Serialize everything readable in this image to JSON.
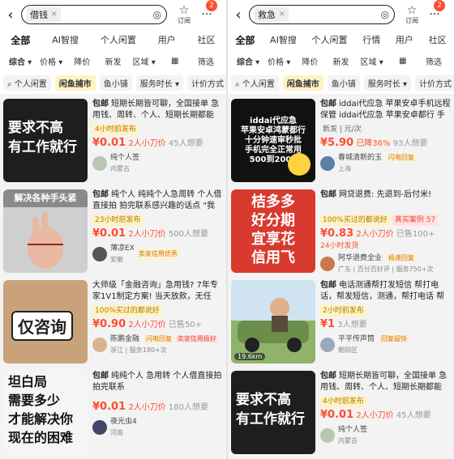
{
  "left": {
    "search_chip": "借钱",
    "fav_label": "订阅",
    "badge": "2",
    "tabs": [
      "全部",
      "AI智搜",
      "个人闲置",
      "用户",
      "社区"
    ],
    "filters": [
      "综合",
      "价格",
      "降价",
      "新发",
      "区域",
      "筛选"
    ],
    "pills": [
      "个人闲置",
      "闲鱼捕市",
      "鱼小铺",
      "服务时长",
      "计价方式"
    ],
    "items": [
      {
        "thumb_text": "要求不高\n有工作就行",
        "title": "短期长期皆可聊，全国接单 急用钱、周转、个人、短期长期都能",
        "tag": "4小时前发布",
        "price": "¥0.01",
        "sub": "2人小刀价",
        "want": "45人想要",
        "seller": "纯个人签",
        "loc": "内蒙古",
        "badges": []
      },
      {
        "thumb_text": "解决各种手头紧",
        "title": "纯个人 纯纯个人急周转 个人借直接拍 拍完联系感兴趣的话点 \"我",
        "tag": "23小时前发布",
        "price": "¥0.01",
        "sub": "2人小刀价",
        "want": "500人想要",
        "seller": "薄凉EX",
        "loc": "安徽",
        "badges": [
          "卖家信用优秀"
        ]
      },
      {
        "thumb_text": "仅咨询",
        "title": "大师级「金融咨询」急用钱? 7年专家1V1制定方案! 当天放款，无任",
        "tag": "100%买过的都说好",
        "price": "¥0.90",
        "sub": "2人小刀价",
        "want": "已售50+",
        "seller": "陈鹏金融",
        "loc": "浙江",
        "loc2": "服务180+次",
        "badges": [
          "闪电回复",
          "卖家信用极好"
        ]
      },
      {
        "thumb_text": "坦白局\n需要多少\n才能解决你\n现在的困难",
        "title": "纯纯个人 急用转 个人借直接拍 拍完联系",
        "tag": "",
        "price": "¥0.01",
        "sub": "2人小刀价",
        "want": "180人想要",
        "seller": "夜光虫4",
        "loc": "河南",
        "badges": []
      }
    ]
  },
  "right": {
    "search_chip": "救急",
    "fav_label": "订阅",
    "badge": "2",
    "tabs": [
      "全部",
      "AI智搜",
      "个人闲置",
      "行情",
      "用户",
      "社区"
    ],
    "filters": [
      "综合",
      "价格",
      "降价",
      "新发",
      "区域",
      "筛选"
    ],
    "pills": [
      "个人闲置",
      "闲鱼捕市",
      "鱼小铺",
      "服务时长",
      "计价方式"
    ],
    "items": [
      {
        "thumb_text": "iddai代应急\n苹果安卓鸿蒙都行\n十分钟速审秒批\n手机完全正常用\n500到2000",
        "title": "iddai代应急 苹果安卓手机远程保管 iddai代应急 苹果安卓都行 手机远",
        "tag": "新发 | 元/次",
        "price": "¥5.90",
        "sub": "已降36%",
        "want": "93人想要",
        "seller": "春城清新的玉",
        "loc": "上海",
        "badges": [
          "闪电回复"
        ]
      },
      {
        "thumb_text": "桔多多\n好分期\n宜享花\n信用飞",
        "title": "网贷退费: 先退到-后付米!",
        "tag": "100%买过的都说好",
        "tag2": "真实案例 57",
        "price": "¥0.83",
        "sub": "2人小刀价",
        "want": "已售100+",
        "seller": "阿华退费全业",
        "loc": "广东",
        "loc2": "百分百好评",
        "loc3": "服务750+次",
        "badges": [
          "极速回复"
        ],
        "extra": "24小时发货"
      },
      {
        "thumb_text": "19.6km",
        "title": "电话测通帮打发短信 帮打电话，帮发短信，测通，帮打电话 帮",
        "tag": "2小时前发布",
        "price": "¥1",
        "sub": "3人想要",
        "want": "",
        "seller": "平平传声筒",
        "loc": "朝阳区",
        "badges": [
          "回复超快"
        ]
      },
      {
        "thumb_text": "要求不高\n有工作就行",
        "title": "短期长期皆可聊，全国接单 急用钱、周转、个人、短期长期都能",
        "tag": "4小时前发布",
        "price": "¥0.01",
        "sub": "2人小刀价",
        "want": "45人想要",
        "seller": "纯个人签",
        "loc": "内蒙古",
        "badges": []
      }
    ]
  },
  "common": {
    "baoyou": "包邮",
    "back": "‹",
    "camera": "◎",
    "more": "···"
  }
}
